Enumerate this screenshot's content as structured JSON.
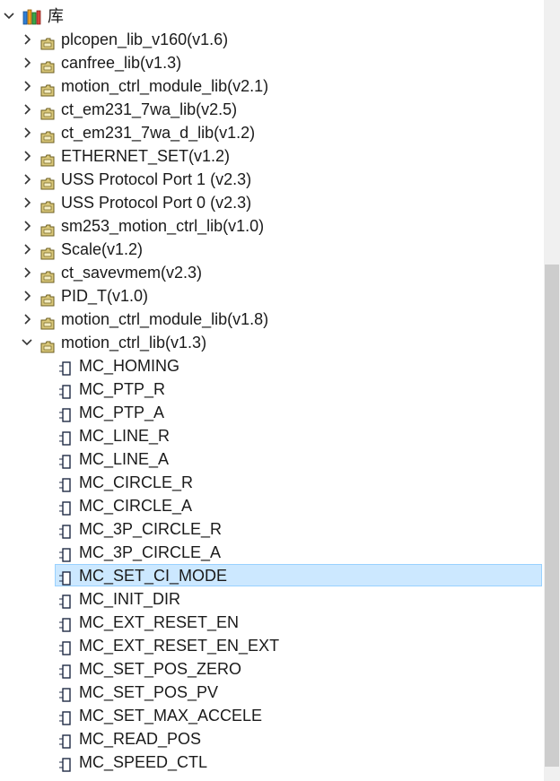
{
  "tree": {
    "root": {
      "label": "库",
      "expanded": true
    },
    "libraries": [
      {
        "label": "plcopen_lib_v160(v1.6)",
        "expanded": false
      },
      {
        "label": "canfree_lib(v1.3)",
        "expanded": false
      },
      {
        "label": "motion_ctrl_module_lib(v2.1)",
        "expanded": false
      },
      {
        "label": "ct_em231_7wa_lib(v2.5)",
        "expanded": false
      },
      {
        "label": "ct_em231_7wa_d_lib(v1.2)",
        "expanded": false
      },
      {
        "label": "ETHERNET_SET(v1.2)",
        "expanded": false
      },
      {
        "label": "USS Protocol Port 1 (v2.3)",
        "expanded": false
      },
      {
        "label": "USS Protocol Port 0 (v2.3)",
        "expanded": false
      },
      {
        "label": "sm253_motion_ctrl_lib(v1.0)",
        "expanded": false
      },
      {
        "label": "Scale(v1.2)",
        "expanded": false
      },
      {
        "label": "ct_savevmem(v2.3)",
        "expanded": false
      },
      {
        "label": "PID_T(v1.0)",
        "expanded": false
      },
      {
        "label": "motion_ctrl_module_lib(v1.8)",
        "expanded": false
      },
      {
        "label": "motion_ctrl_lib(v1.3)",
        "expanded": true
      }
    ],
    "blocks": [
      {
        "label": "MC_HOMING",
        "selected": false
      },
      {
        "label": "MC_PTP_R",
        "selected": false
      },
      {
        "label": "MC_PTP_A",
        "selected": false
      },
      {
        "label": "MC_LINE_R",
        "selected": false
      },
      {
        "label": "MC_LINE_A",
        "selected": false
      },
      {
        "label": "MC_CIRCLE_R",
        "selected": false
      },
      {
        "label": "MC_CIRCLE_A",
        "selected": false
      },
      {
        "label": "MC_3P_CIRCLE_R",
        "selected": false
      },
      {
        "label": "MC_3P_CIRCLE_A",
        "selected": false
      },
      {
        "label": "MC_SET_CI_MODE",
        "selected": true
      },
      {
        "label": "MC_INIT_DIR",
        "selected": false
      },
      {
        "label": "MC_EXT_RESET_EN",
        "selected": false
      },
      {
        "label": "MC_EXT_RESET_EN_EXT",
        "selected": false
      },
      {
        "label": "MC_SET_POS_ZERO",
        "selected": false
      },
      {
        "label": "MC_SET_POS_PV",
        "selected": false
      },
      {
        "label": "MC_SET_MAX_ACCELE",
        "selected": false
      },
      {
        "label": "MC_READ_POS",
        "selected": false
      },
      {
        "label": "MC_SPEED_CTL",
        "selected": false
      }
    ]
  },
  "icons": {
    "root": "library-books-icon",
    "library": "library-folder-icon",
    "block": "program-block-icon",
    "collapsed": "chevron-right-icon",
    "expanded": "chevron-down-icon"
  },
  "colors": {
    "selection_bg": "#cce8ff",
    "selection_border": "#99d1ff",
    "folder_fill": "#d9c77a",
    "folder_stroke": "#6b5d1f",
    "block_fill": "#ffffff",
    "block_stroke": "#1f2a44"
  }
}
